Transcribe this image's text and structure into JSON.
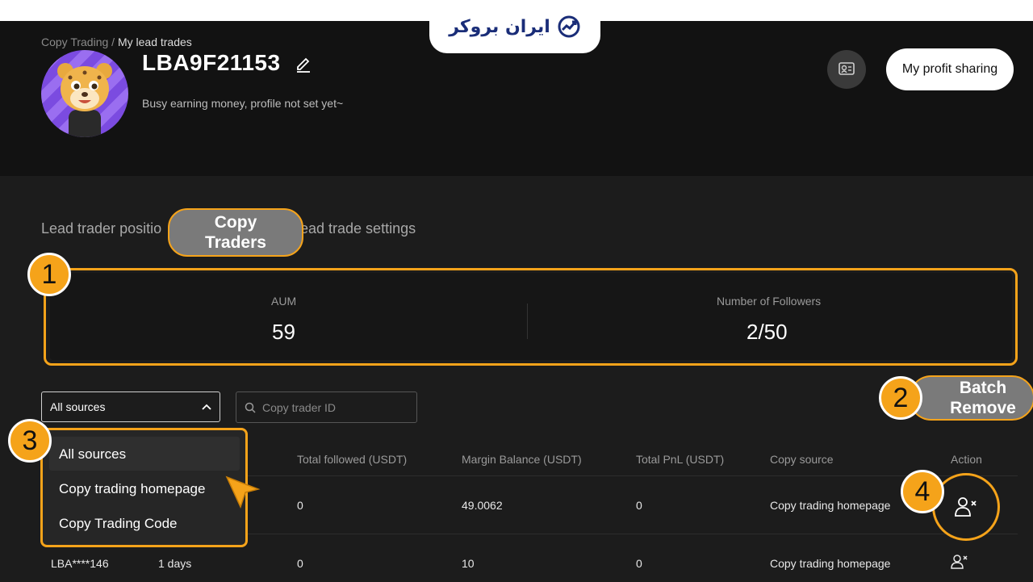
{
  "header": {
    "breadcrumb": {
      "parent": "Copy Trading",
      "separator": "/",
      "current": "My lead trades"
    },
    "logo_text": "ایران بروکر",
    "username": "LBA9F21153",
    "bio": "Busy earning money, profile not set yet~",
    "profit_sharing_label": "My profit sharing"
  },
  "tabs": {
    "lead_trader_positions": "Lead trader positio",
    "copy_traders": "Copy Traders",
    "lead_trade_settings": "ead trade settings"
  },
  "stats": {
    "aum_label": "AUM",
    "aum_value": "59",
    "followers_label": "Number of Followers",
    "followers_value": "2/50"
  },
  "callouts": {
    "batch_remove": "Batch Remove",
    "badge_1": "1",
    "badge_2": "2",
    "badge_3": "3",
    "badge_4": "4"
  },
  "filters": {
    "source_selected": "All sources",
    "search_placeholder": "Copy trader ID",
    "source_options": [
      "All sources",
      "Copy trading homepage",
      "Copy Trading Code"
    ]
  },
  "table": {
    "columns": {
      "total_followed": "Total followed (USDT)",
      "margin_balance": "Margin Balance (USDT)",
      "total_pnl": "Total PnL (USDT)",
      "copy_source": "Copy source",
      "action": "Action"
    },
    "rows": [
      {
        "total_followed": "0",
        "margin_balance": "49.0062",
        "total_pnl": "0",
        "copy_source": "Copy trading homepage"
      },
      {
        "trader": "LBA****146",
        "duration": "1 days",
        "total_followed": "0",
        "margin_balance": "10",
        "total_pnl": "0",
        "copy_source": "Copy trading homepage"
      }
    ]
  },
  "colors": {
    "accent": "#f5a31a",
    "background": "#1c1c1c",
    "header_bg": "#121212"
  }
}
